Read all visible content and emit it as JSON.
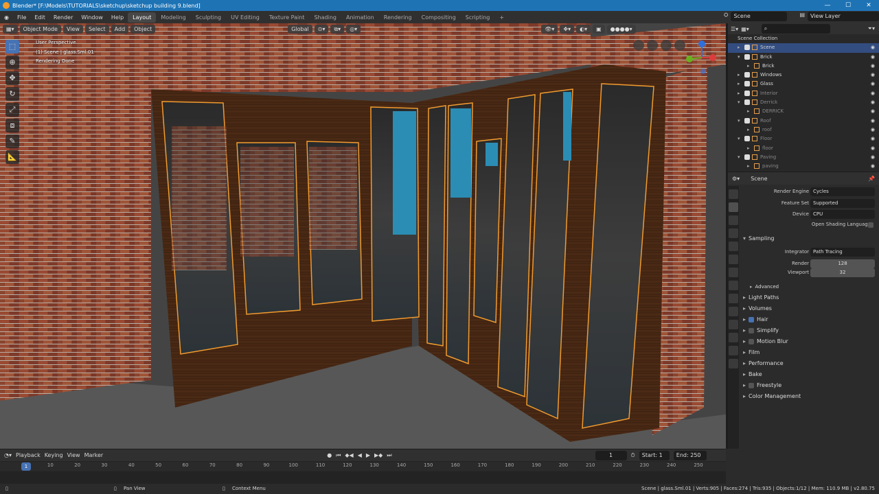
{
  "titlebar": {
    "title": "Blender* [F:\\Models\\TUTORIALS\\sketchup\\sketchup building 9.blend]"
  },
  "menu": {
    "items": [
      "File",
      "Edit",
      "Render",
      "Window",
      "Help"
    ]
  },
  "workspaces": [
    "Layout",
    "Modeling",
    "Sculpting",
    "UV Editing",
    "Texture Paint",
    "Shading",
    "Animation",
    "Rendering",
    "Compositing",
    "Scripting"
  ],
  "scene_field": "Scene",
  "viewlayer_field": "View Layer",
  "viewport_header": {
    "mode": "Object Mode",
    "view": "View",
    "select": "Select",
    "add": "Add",
    "object": "Object",
    "transform": "Global"
  },
  "viewport_info": {
    "line1": "User Perspective",
    "line2": "(1) Scene | glass.Sml.01",
    "line3": "Rendering Done"
  },
  "outliner": {
    "title": "Scene Collection",
    "rows": [
      {
        "label": "Scene",
        "selected": true,
        "dim": false,
        "chevron": "▸",
        "checkbox": true
      },
      {
        "label": "Brick",
        "selected": false,
        "dim": false,
        "chevron": "▾",
        "checkbox": true
      },
      {
        "label": "Brick",
        "selected": false,
        "dim": false,
        "chevron": "▸",
        "checkbox": false
      },
      {
        "label": "Windows",
        "selected": false,
        "dim": false,
        "chevron": "▸",
        "checkbox": true
      },
      {
        "label": "Glass",
        "selected": false,
        "dim": false,
        "chevron": "▸",
        "checkbox": true
      },
      {
        "label": "Interior",
        "selected": false,
        "dim": true,
        "chevron": "▸",
        "checkbox": true
      },
      {
        "label": "Derrick",
        "selected": false,
        "dim": true,
        "chevron": "▾",
        "checkbox": true
      },
      {
        "label": "DERRICK",
        "selected": false,
        "dim": true,
        "chevron": "▸",
        "checkbox": false
      },
      {
        "label": "Roof",
        "selected": false,
        "dim": true,
        "chevron": "▾",
        "checkbox": true
      },
      {
        "label": "roof",
        "selected": false,
        "dim": true,
        "chevron": "▸",
        "checkbox": false
      },
      {
        "label": "Floor",
        "selected": false,
        "dim": true,
        "chevron": "▾",
        "checkbox": true
      },
      {
        "label": "floor",
        "selected": false,
        "dim": true,
        "chevron": "▸",
        "checkbox": false
      },
      {
        "label": "Paving",
        "selected": false,
        "dim": true,
        "chevron": "▾",
        "checkbox": true
      },
      {
        "label": "paving",
        "selected": false,
        "dim": true,
        "chevron": "▸",
        "checkbox": false
      }
    ]
  },
  "properties": {
    "context": "Scene",
    "render_engine_label": "Render Engine",
    "render_engine": "Cycles",
    "feature_set_label": "Feature Set",
    "feature_set": "Supported",
    "device_label": "Device",
    "device": "CPU",
    "osl_label": "Open Shading Language",
    "sampling": "Sampling",
    "integrator_label": "Integrator",
    "integrator": "Path Tracing",
    "render_label": "Render",
    "render_samples": "128",
    "viewport_label": "Viewport",
    "viewport_samples": "32",
    "advanced": "Advanced",
    "sections": [
      "Light Paths",
      "Volumes",
      "Hair",
      "Simplify",
      "Motion Blur",
      "Film",
      "Performance",
      "Bake",
      "Freestyle",
      "Color Management"
    ]
  },
  "timeline": {
    "playback": "Playback",
    "keying": "Keying",
    "view": "View",
    "marker": "Marker",
    "current_frame": "1",
    "start_label": "Start:",
    "start": "1",
    "end_label": "End:",
    "end": "250",
    "ticks": [
      "10",
      "20",
      "30",
      "40",
      "50",
      "60",
      "70",
      "80",
      "90",
      "100",
      "110",
      "120",
      "130",
      "140",
      "150",
      "160",
      "170",
      "180",
      "190",
      "200",
      "210",
      "220",
      "230",
      "240",
      "250"
    ]
  },
  "status": {
    "pan": "Pan View",
    "context": "Context Menu",
    "stats": "Scene | glass.Sml.01 | Verts:905 | Faces:274 | Tris:935 | Objects:1/12 | Mem: 110.9 MB | v2.80.75"
  },
  "colors": {
    "accent": "#4772b3",
    "title_bar": "#1e73b5",
    "selection_outline": "#f29b2e"
  }
}
